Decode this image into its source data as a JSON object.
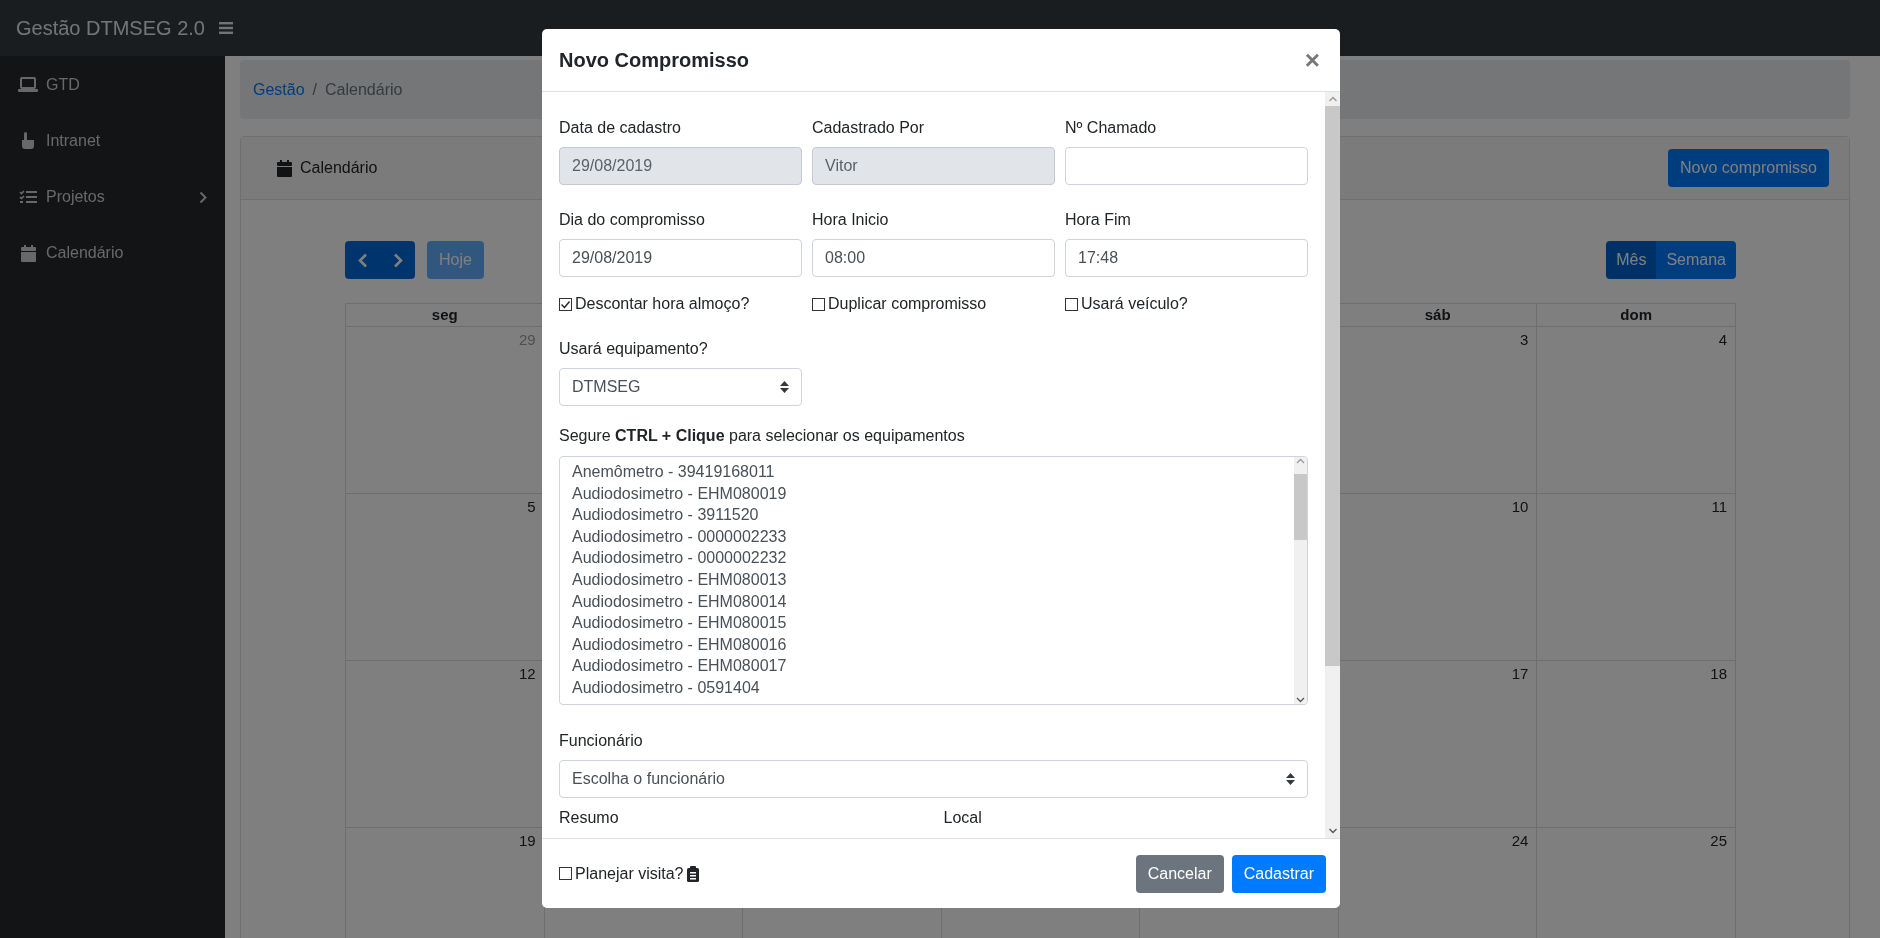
{
  "navbar": {
    "brand": "Gestão DTMSEG 2.0"
  },
  "sidebar": {
    "items": [
      {
        "label": "GTD",
        "has_submenu": false
      },
      {
        "label": "Intranet",
        "has_submenu": false
      },
      {
        "label": "Projetos",
        "has_submenu": true
      },
      {
        "label": "Calendário",
        "has_submenu": false
      }
    ]
  },
  "breadcrumb": {
    "separator": "/",
    "items": [
      {
        "label": "Gestão",
        "link": true
      },
      {
        "label": "Calendário",
        "link": false
      }
    ]
  },
  "card": {
    "title": "Calendário",
    "new_button": "Novo compromisso"
  },
  "calendar": {
    "today_button": {
      "label": "Hoje",
      "disabled": true
    },
    "views": [
      {
        "label": "Mês",
        "selected": true
      },
      {
        "label": "Semana",
        "selected": false
      }
    ],
    "headers": [
      "seg",
      "sáb",
      "dom"
    ],
    "weeks": [
      {
        "days": [
          {
            "day": "29",
            "muted": true
          },
          {
            "day": "3",
            "muted": false
          },
          {
            "day": "4",
            "muted": false
          }
        ]
      },
      {
        "days": [
          {
            "day": "5",
            "muted": false
          },
          {
            "day": "10",
            "muted": false
          },
          {
            "day": "11",
            "muted": false
          }
        ]
      },
      {
        "days": [
          {
            "day": "12",
            "muted": false
          },
          {
            "day": "17",
            "muted": false
          },
          {
            "day": "18",
            "muted": false
          }
        ]
      },
      {
        "days": [
          {
            "day": "19",
            "muted": false
          },
          {
            "day": "24",
            "muted": false
          },
          {
            "day": "25",
            "muted": false
          }
        ]
      }
    ]
  },
  "modal": {
    "title": "Novo Compromisso",
    "close": "×",
    "fields": [
      {
        "label": "Data de cadastro",
        "value": "29/08/2019",
        "readonly": true
      },
      {
        "label": "Cadastrado Por",
        "value": "Vitor",
        "readonly": true
      },
      {
        "label": "Nº Chamado",
        "readonly": false
      },
      {
        "label": "Dia do compromisso",
        "value": "29/08/2019",
        "readonly": false
      },
      {
        "label": "Hora Inicio",
        "value": "08:00",
        "readonly": false
      },
      {
        "label": "Hora Fim",
        "value": "17:48",
        "readonly": false
      }
    ],
    "checkboxes": [
      {
        "label": "Descontar hora almoço?",
        "checked": true
      },
      {
        "label": "Duplicar compromisso",
        "checked": false
      },
      {
        "label": "Usará veículo?",
        "checked": false
      }
    ],
    "equipment_select": {
      "label": "Usará equipamento?",
      "value": "DTMSEG"
    },
    "hint": "Segure **CTRL + Clique** para selecionar os equipamentos",
    "equipment_list": [
      "Anemômetro - 39419168011",
      "Audiodosimetro - EHM080019",
      "Audiodosimetro - 3911520",
      "Audiodosimetro - 0000002233",
      "Audiodosimetro - 0000002232",
      "Audiodosimetro - EHM080013",
      "Audiodosimetro - EHM080014",
      "Audiodosimetro - EHM080015",
      "Audiodosimetro - EHM080016",
      "Audiodosimetro - EHM080017",
      "Audiodosimetro - 0591404"
    ],
    "employee_select": {
      "label": "Funcionário",
      "value": "Escolha o funcionário"
    },
    "more_labels": [
      "Resumo",
      "Local"
    ],
    "footer": {
      "checkbox": {
        "label": "Planejar visita?",
        "checked": false
      },
      "buttons": [
        {
          "label": "Cancelar",
          "kind": "secondary"
        },
        {
          "label": "Cadastrar",
          "kind": "primary"
        }
      ]
    }
  }
}
